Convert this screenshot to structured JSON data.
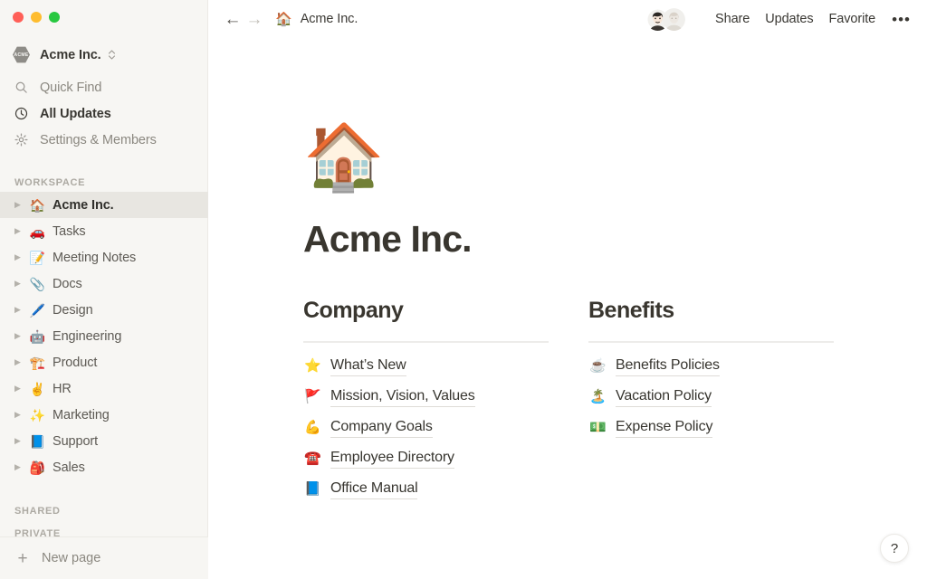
{
  "window": {
    "traffic_lights": [
      {
        "name": "close",
        "color": "#ff5f57"
      },
      {
        "name": "minimize",
        "color": "#febc2e"
      },
      {
        "name": "zoom",
        "color": "#28c840"
      }
    ]
  },
  "sidebar": {
    "workspace_switcher": {
      "badge_text": "ACME",
      "name": "Acme Inc.",
      "chevron_icon": "chevron-updown-icon"
    },
    "nav": [
      {
        "icon": "search-icon",
        "label": "Quick Find",
        "active": false
      },
      {
        "icon": "clock-icon",
        "label": "All Updates",
        "active": true
      },
      {
        "icon": "gear-icon",
        "label": "Settings & Members",
        "active": false
      }
    ],
    "workspace_section": {
      "title": "WORKSPACE",
      "pages": [
        {
          "emoji": "🏠",
          "label": "Acme Inc.",
          "selected": true
        },
        {
          "emoji": "🚗",
          "label": "Tasks",
          "selected": false
        },
        {
          "emoji": "📝",
          "label": "Meeting Notes",
          "selected": false
        },
        {
          "emoji": "📎",
          "label": "Docs",
          "selected": false
        },
        {
          "emoji": "🖊️",
          "label": "Design",
          "selected": false
        },
        {
          "emoji": "🤖",
          "label": "Engineering",
          "selected": false
        },
        {
          "emoji": "🏗️",
          "label": "Product",
          "selected": false
        },
        {
          "emoji": "✌️",
          "label": "HR",
          "selected": false
        },
        {
          "emoji": "✨",
          "label": "Marketing",
          "selected": false
        },
        {
          "emoji": "📘",
          "label": "Support",
          "selected": false
        },
        {
          "emoji": "🎒",
          "label": "Sales",
          "selected": false
        }
      ]
    },
    "shared_section": {
      "title": "SHARED"
    },
    "private_section": {
      "title": "PRIVATE"
    },
    "footer": {
      "icon": "plus-icon",
      "label": "New page"
    }
  },
  "topbar": {
    "back_icon": "arrow-left-icon",
    "forward_icon": "arrow-right-icon",
    "breadcrumb": {
      "emoji": "🏠",
      "label": "Acme Inc."
    },
    "avatars": [
      {
        "name": "collaborator-avatar-1"
      },
      {
        "name": "collaborator-avatar-2"
      }
    ],
    "actions": [
      "Share",
      "Updates",
      "Favorite"
    ],
    "more_icon": "•••"
  },
  "page": {
    "icon": "🏠",
    "title": "Acme Inc.",
    "columns": [
      {
        "heading": "Company",
        "links": [
          {
            "emoji": "⭐",
            "label": "What’s New"
          },
          {
            "emoji": "🚩",
            "label": "Mission, Vision, Values"
          },
          {
            "emoji": "💪",
            "label": "Company Goals"
          },
          {
            "emoji": "☎️",
            "label": "Employee Directory"
          },
          {
            "emoji": "📘",
            "label": "Office Manual"
          }
        ]
      },
      {
        "heading": "Benefits",
        "links": [
          {
            "emoji": "☕",
            "label": "Benefits Policies"
          },
          {
            "emoji": "🏝️",
            "label": "Vacation Policy"
          },
          {
            "emoji": "💵",
            "label": "Expense Policy"
          }
        ]
      }
    ]
  },
  "help_button": {
    "label": "?"
  }
}
